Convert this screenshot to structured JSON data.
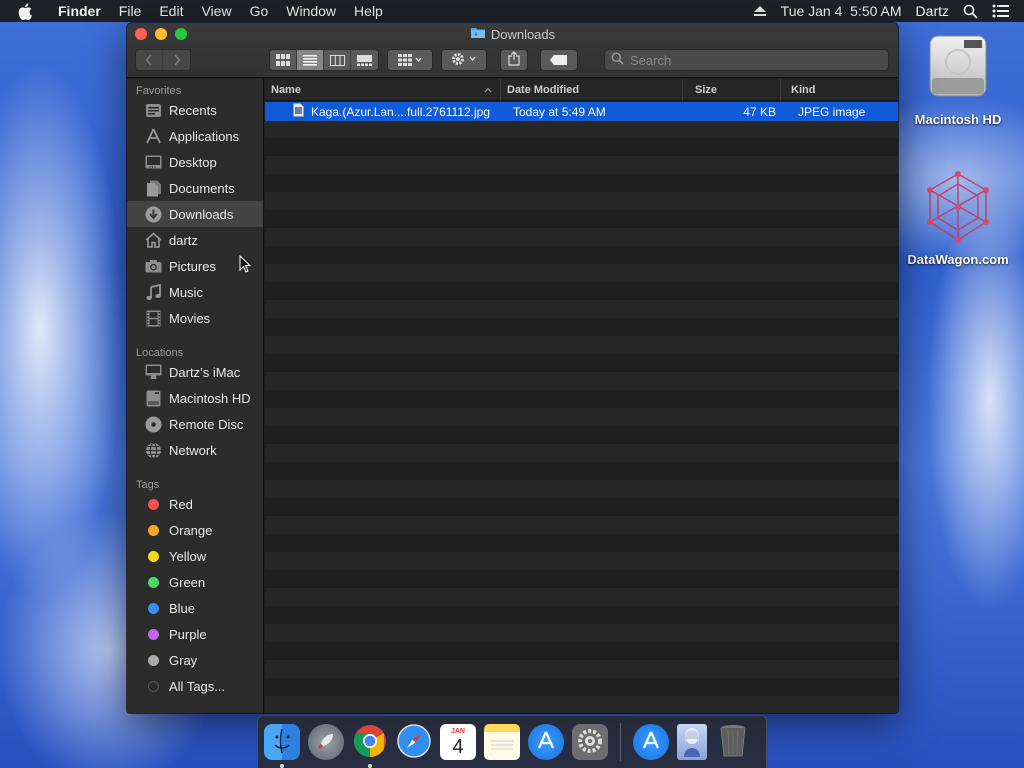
{
  "menubar": {
    "app_name": "Finder",
    "menus": [
      "File",
      "Edit",
      "View",
      "Go",
      "Window",
      "Help"
    ],
    "datetime": "Tue Jan 4  5:50 AM",
    "user": "Dartz"
  },
  "window": {
    "title": "Downloads",
    "search_placeholder": "Search"
  },
  "sidebar": {
    "favorites_header": "Favorites",
    "favorites": [
      {
        "label": "Recents",
        "icon": "clock-icon"
      },
      {
        "label": "Applications",
        "icon": "applications-icon"
      },
      {
        "label": "Desktop",
        "icon": "desktop-icon"
      },
      {
        "label": "Documents",
        "icon": "documents-icon"
      },
      {
        "label": "Downloads",
        "icon": "downloads-icon",
        "selected": true
      },
      {
        "label": "dartz",
        "icon": "home-icon"
      },
      {
        "label": "Pictures",
        "icon": "camera-icon"
      },
      {
        "label": "Music",
        "icon": "music-note-icon"
      },
      {
        "label": "Movies",
        "icon": "film-icon"
      }
    ],
    "locations_header": "Locations",
    "locations": [
      {
        "label": "Dartz’s iMac",
        "icon": "imac-icon"
      },
      {
        "label": "Macintosh HD",
        "icon": "hard-drive-icon"
      },
      {
        "label": "Remote Disc",
        "icon": "disc-icon"
      },
      {
        "label": "Network",
        "icon": "globe-icon"
      }
    ],
    "tags_header": "Tags",
    "tags": [
      {
        "label": "Red",
        "color": "#f4524d"
      },
      {
        "label": "Orange",
        "color": "#f5a623"
      },
      {
        "label": "Yellow",
        "color": "#f7d51d"
      },
      {
        "label": "Green",
        "color": "#4cd964"
      },
      {
        "label": "Blue",
        "color": "#3b8df5"
      },
      {
        "label": "Purple",
        "color": "#c265e6"
      },
      {
        "label": "Gray",
        "color": "#a9a9a9"
      },
      {
        "label": "All Tags...",
        "color": "#555555"
      }
    ]
  },
  "filelist": {
    "columns": {
      "name": "Name",
      "date": "Date Modified",
      "size": "Size",
      "kind": "Kind"
    },
    "rows": [
      {
        "name": "Kaga.(Azur.Lan....full.2761112.jpg",
        "date": "Today at 5:49 AM",
        "size": "47 KB",
        "kind": "JPEG image",
        "selected": true
      }
    ]
  },
  "desktop": {
    "icons": [
      {
        "label": "Macintosh HD",
        "icon": "hard-drive-icon"
      },
      {
        "label": "DataWagon.com",
        "icon": "molecule-icon"
      }
    ]
  },
  "dock": {
    "apps": [
      "finder",
      "launchpad",
      "chrome",
      "safari",
      "calendar",
      "notes",
      "app-store",
      "system-preferences",
      "app-store-download",
      "image-preview",
      "trash"
    ],
    "calendar": {
      "month": "JAN",
      "day": "4"
    }
  },
  "colors": {
    "selection": "#0f5bd8",
    "sidebar_bg": "#2c2c2c",
    "window_bg": "#1e1e1e"
  }
}
